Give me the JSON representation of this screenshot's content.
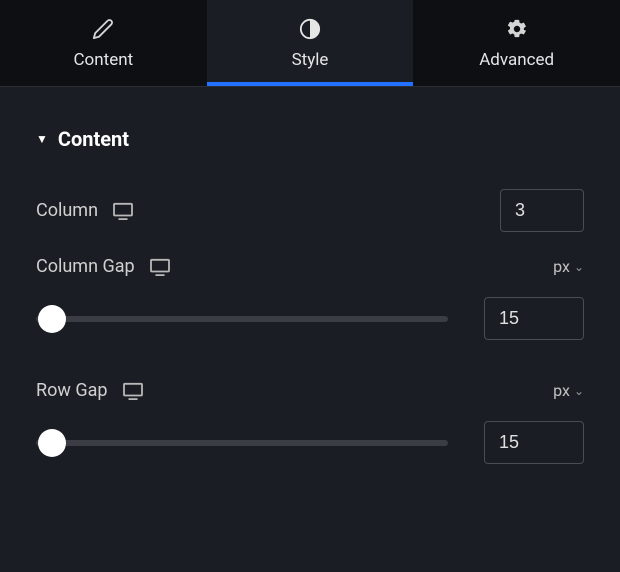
{
  "tabs": {
    "content": "Content",
    "style": "Style",
    "advanced": "Advanced",
    "active": "style"
  },
  "section": {
    "title": "Content"
  },
  "controls": {
    "column": {
      "label": "Column",
      "value": "3"
    },
    "column_gap": {
      "label": "Column Gap",
      "unit": "px",
      "value": "15"
    },
    "row_gap": {
      "label": "Row Gap",
      "unit": "px",
      "value": "15"
    }
  }
}
